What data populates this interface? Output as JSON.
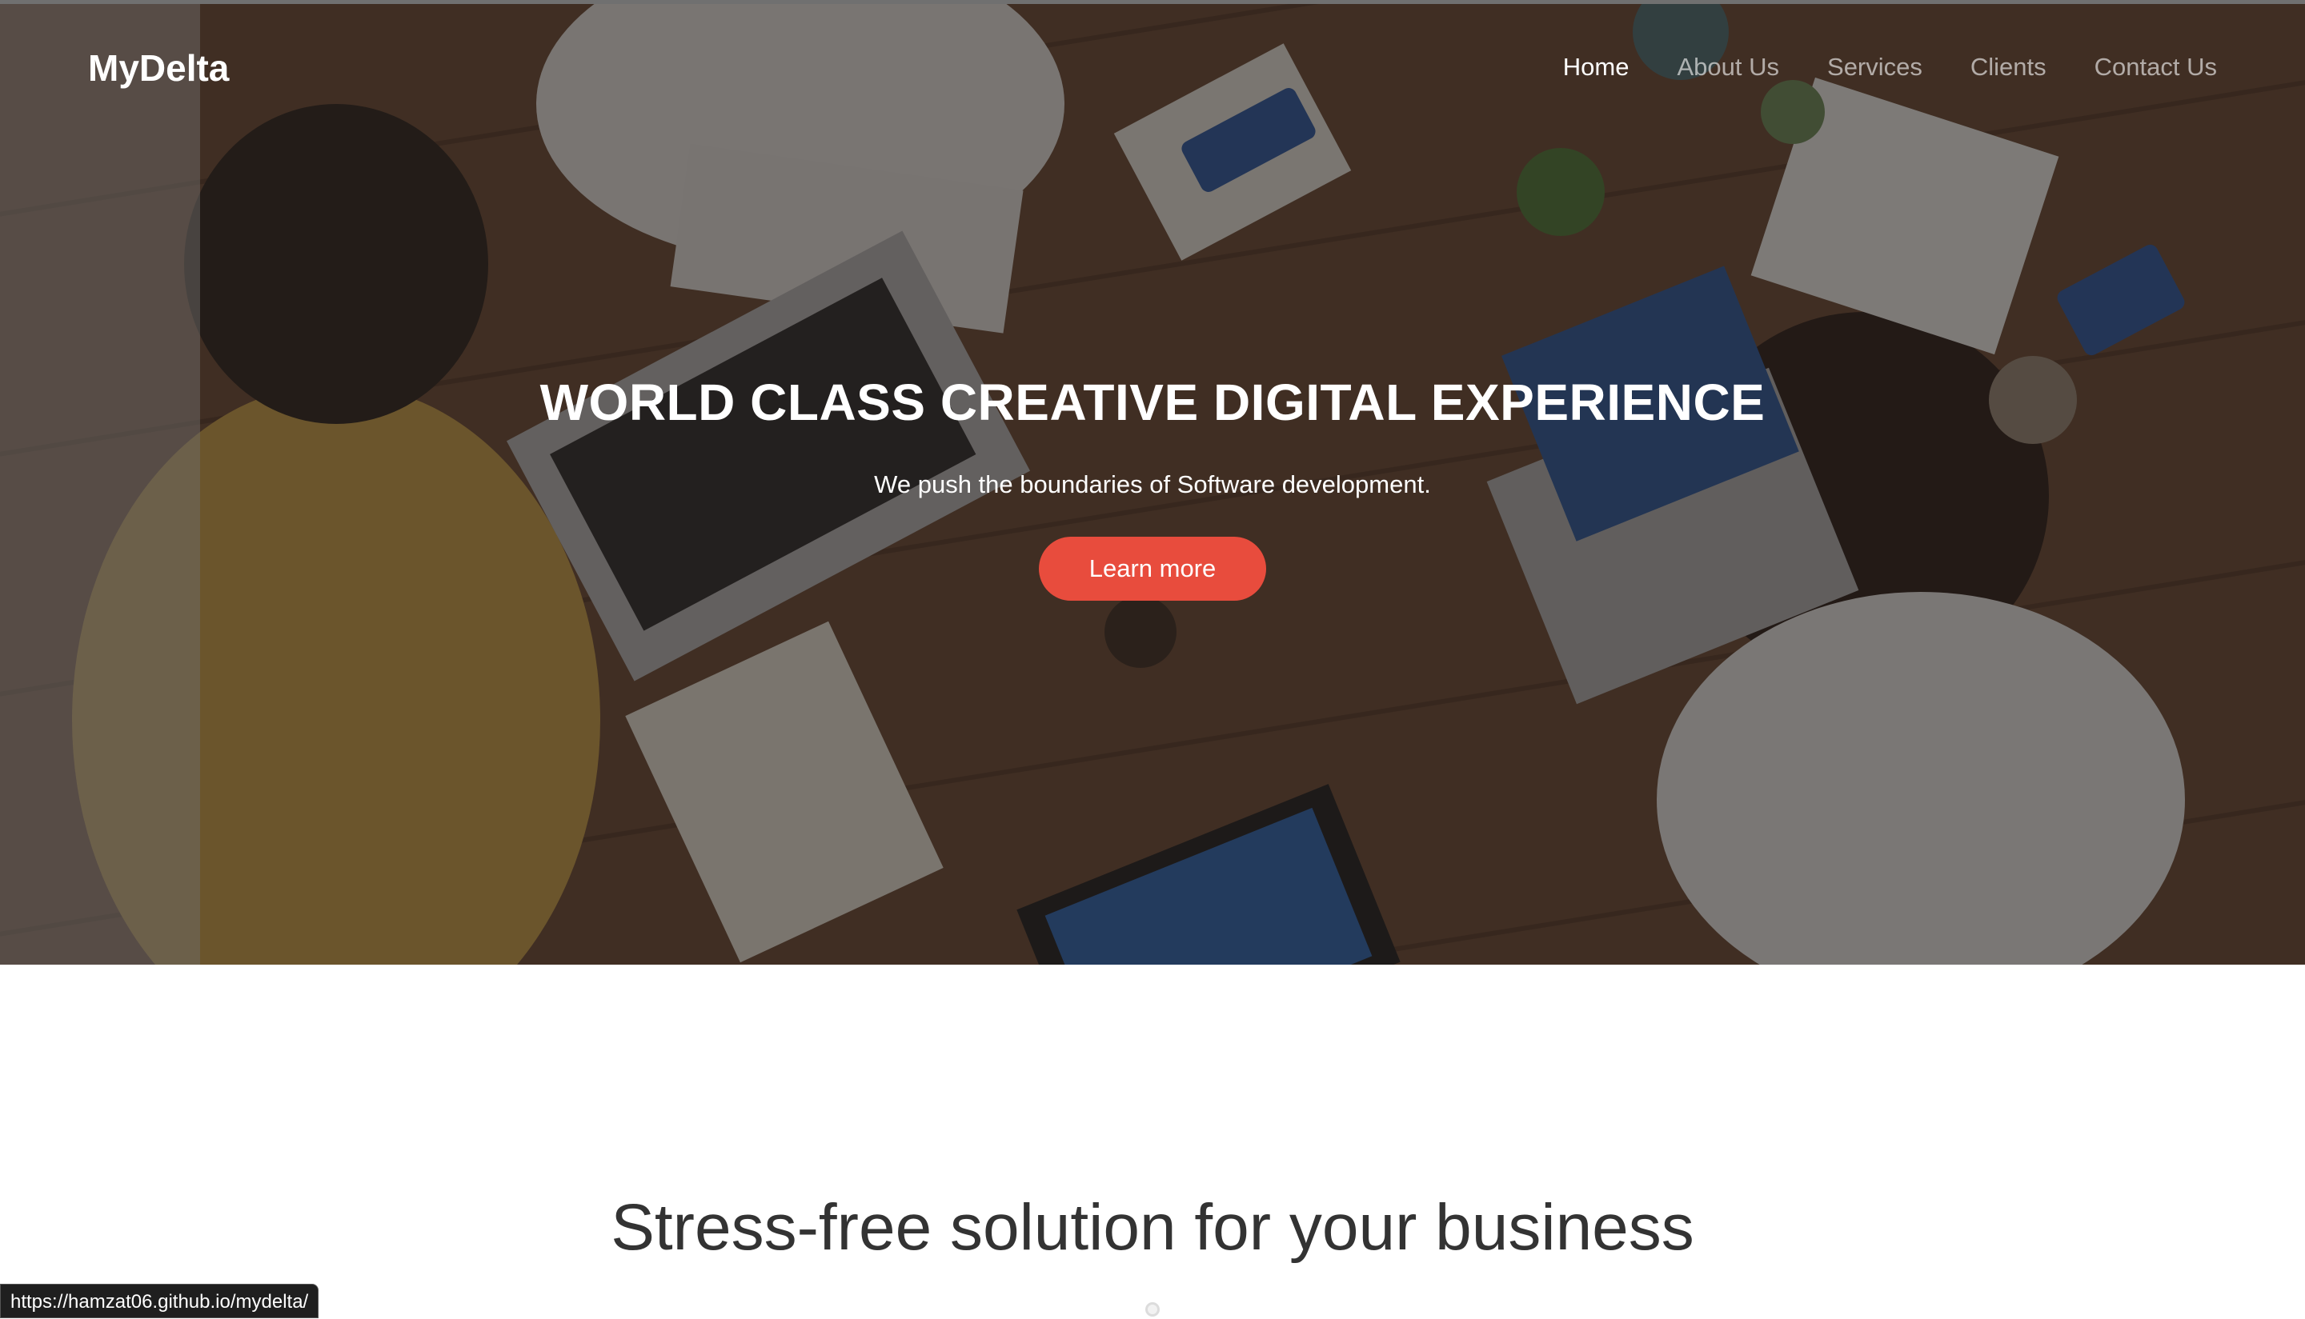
{
  "nav": {
    "brand": "MyDelta",
    "items": [
      "Home",
      "About Us",
      "Services",
      "Clients",
      "Contact Us"
    ],
    "active": "Home"
  },
  "hero": {
    "title": "WORLD CLASS CREATIVE DIGITAL EXPERIENCE",
    "subtitle": "We push the boundaries of Software development.",
    "cta_label": "Learn more",
    "image": "hero-background-meeting-photo"
  },
  "section": {
    "title": "Stress-free solution for your business"
  },
  "status_bar": {
    "url": "https://hamzat06.github.io/mydelta/"
  },
  "colors": {
    "accent": "#e84c3d",
    "text_dark": "#333333",
    "nav_inactive": "rgba(255,255,255,0.6)"
  }
}
